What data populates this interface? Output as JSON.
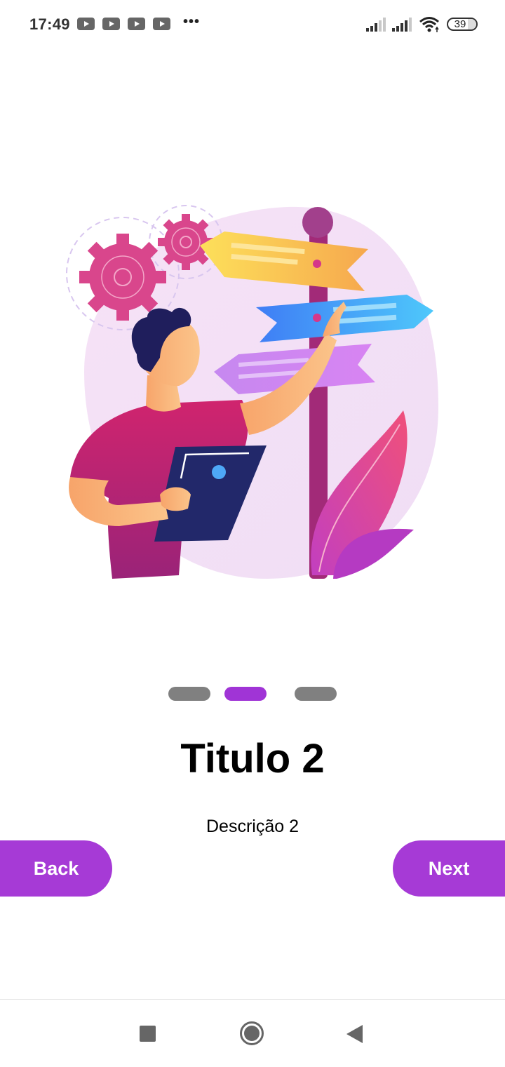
{
  "status_bar": {
    "time": "17:49",
    "notification_icons": [
      "youtube-icon",
      "youtube-icon",
      "youtube-icon",
      "youtube-icon"
    ],
    "more_indicator": "•••",
    "battery_level": "39"
  },
  "onboarding": {
    "illustration": "person-at-signpost-illustration",
    "page_indicator": {
      "total": 3,
      "current": 2
    },
    "title": "Titulo 2",
    "description": "Descrição 2",
    "back_label": "Back",
    "next_label": "Next"
  },
  "colors": {
    "accent": "#a63ad6",
    "inactive_dot": "#808080"
  },
  "nav_bar": {
    "buttons": [
      "recents",
      "home",
      "back"
    ]
  }
}
